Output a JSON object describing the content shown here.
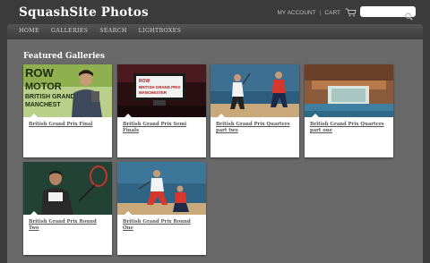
{
  "site": {
    "title": "SquashSite Photos"
  },
  "header": {
    "account_label": "MY ACCOUNT",
    "separator": "|",
    "cart_label": "CART",
    "search_placeholder": ""
  },
  "nav": {
    "items": [
      {
        "label": "HOME"
      },
      {
        "label": "GALLERIES"
      },
      {
        "label": "SEARCH"
      },
      {
        "label": "LIGHTBOXES"
      }
    ]
  },
  "main": {
    "section_title": "Featured Galleries",
    "galleries": [
      {
        "title": "British Grand Prix Final",
        "thumb_icon": "banner-photo-icon",
        "thumb_text": [
          "ROW",
          "MOTOR",
          "BRITISH GRAND",
          "MANCHEST"
        ]
      },
      {
        "title": "British Grand Prix Semi Finals",
        "thumb_icon": "screen-photo-icon",
        "thumb_text": [
          "ROW",
          "BRITISH GRAND PRIX",
          "MANCHESTER"
        ]
      },
      {
        "title": "British Grand Prix Quarters part two",
        "thumb_icon": "court-players-icon"
      },
      {
        "title": "British Grand Prix Quarters part one",
        "thumb_icon": "arena-photo-icon"
      },
      {
        "title": "British Grand Prix Round Two",
        "thumb_icon": "player-photo-icon"
      },
      {
        "title": "British Grand Prix Round One",
        "thumb_icon": "court-action-icon"
      }
    ]
  },
  "colors": {
    "background": "#3b3b3b",
    "panel": "#696969",
    "card": "#ffffff",
    "caption": "#555555"
  }
}
